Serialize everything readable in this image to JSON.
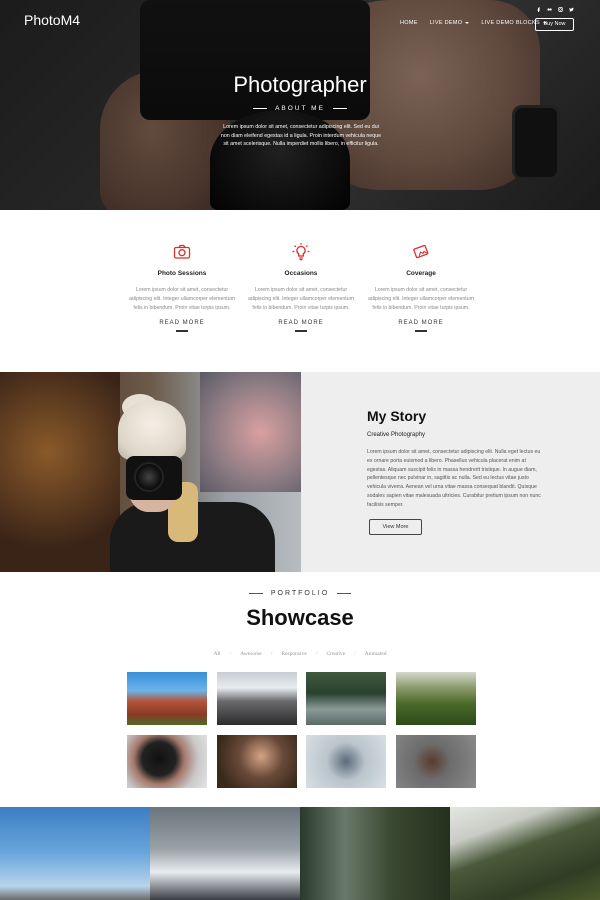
{
  "header": {
    "logo": "PhotoM4",
    "nav": [
      {
        "label": "HOME",
        "dropdown": false
      },
      {
        "label": "LIVE DEMO",
        "dropdown": true
      },
      {
        "label": "LIVE DEMO BLOCKS",
        "dropdown": true
      }
    ],
    "cta": "Buy Now",
    "socials": [
      "facebook-icon",
      "flickr-icon",
      "instagram-icon",
      "twitter-icon"
    ]
  },
  "hero": {
    "title": "Photographer",
    "subtitle": "ABOUT ME",
    "text": "Lorem ipsum dolor sit amet, consectetur adipiscing elit. Sed eu dui non diam eleifend egestas id a ligula. Proin interdum vehicula neque sit amet scelerisque. Nulla imperdiet mollis libero, in efficitur ligula."
  },
  "services": [
    {
      "icon": "camera-icon",
      "title": "Photo Sessions",
      "text": "Lorem ipsum dolor sit amet, consectetur adipiscing elit. Integer ullamcorper elementum felis in bibendum. Proin vitae turpis ipsum.",
      "link": "READ MORE"
    },
    {
      "icon": "lightbulb-icon",
      "title": "Occasions",
      "text": "Lorem ipsum dolor sit amet, consectetur adipiscing elit. Integer ullamcorper elementum felis in bibendum. Proin vitae turpis ipsum.",
      "link": "READ MORE"
    },
    {
      "icon": "photos-icon",
      "title": "Coverage",
      "text": "Lorem ipsum dolor sit amet, consectetur adipiscing elit. Integer ullamcorper elementum felis in bibendum. Proin vitae turpis ipsum.",
      "link": "READ MORE"
    }
  ],
  "story": {
    "title": "My Story",
    "subtitle": "Creative Photography",
    "text": "Lorem ipsum dolor sit amet, consectetur adipiscing elit. Nulla eget lectus eu ex ornare porta euismod a libero. Phasellus vehicula placerat enim at egestas. Aliquam suscipit felis in massa hendrerit tristique. In augue diam, pellentesque nec pulvinar in, sagittis ac nulla. Sed eu lectus vitae justo vehicula viverra. Aenean vel urna vitae massa consequat blandit. Quisque sodales sapien vitae malesuada ultricies. Curabitur pretium ipsum non nunc facilisis semper.",
    "button": "View More"
  },
  "portfolio": {
    "label": "PORTFOLIO",
    "title": "Showcase",
    "filters": [
      "All",
      "Awesome",
      "Responsive",
      "Creative",
      "Animated"
    ]
  },
  "colors": {
    "accent": "#d9302a",
    "story_bg": "#eeeeee"
  }
}
